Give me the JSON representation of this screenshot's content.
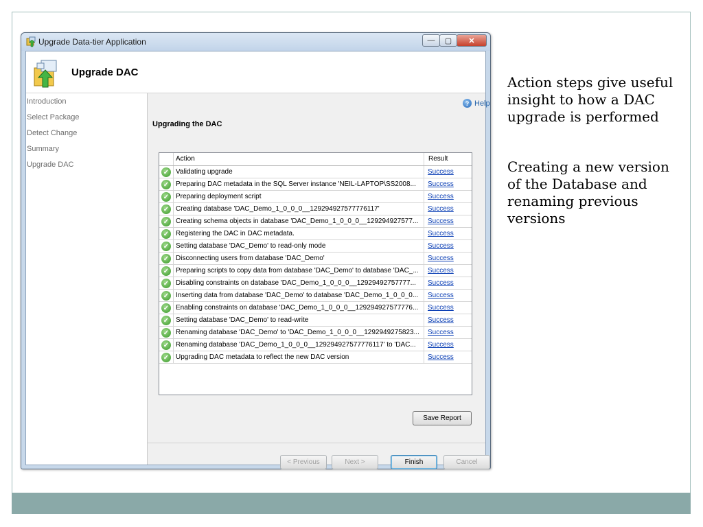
{
  "window": {
    "title": "Upgrade Data-tier Application",
    "header_title": "Upgrade DAC",
    "controls": {
      "minimize": "—",
      "maximize": "▢",
      "close": "✕"
    }
  },
  "nav": {
    "items": [
      {
        "label": "Introduction"
      },
      {
        "label": "Select Package"
      },
      {
        "label": "Detect Change"
      },
      {
        "label": "Summary"
      },
      {
        "label": "Upgrade DAC"
      }
    ]
  },
  "main": {
    "help_label": "Help",
    "section_title": "Upgrading the DAC",
    "columns": {
      "action": "Action",
      "result": "Result"
    },
    "rows": [
      {
        "action": "Validating upgrade",
        "result": "Success"
      },
      {
        "action": "Preparing DAC metadata in the SQL Server instance 'NEIL-LAPTOP\\SS2008...",
        "result": "Success"
      },
      {
        "action": "Preparing deployment script",
        "result": "Success"
      },
      {
        "action": "Creating database 'DAC_Demo_1_0_0_0__129294927577776117'",
        "result": "Success"
      },
      {
        "action": "Creating schema objects in database 'DAC_Demo_1_0_0_0__129294927577...",
        "result": "Success"
      },
      {
        "action": "Registering the DAC in DAC metadata.",
        "result": "Success"
      },
      {
        "action": "Setting database 'DAC_Demo' to read-only mode",
        "result": "Success"
      },
      {
        "action": "Disconnecting users from database 'DAC_Demo'",
        "result": "Success"
      },
      {
        "action": "Preparing scripts to copy data from database 'DAC_Demo' to database 'DAC_...",
        "result": "Success"
      },
      {
        "action": "Disabling constraints on database 'DAC_Demo_1_0_0_0__12929492757777...",
        "result": "Success"
      },
      {
        "action": "Inserting data from database 'DAC_Demo' to database 'DAC_Demo_1_0_0_0...",
        "result": "Success"
      },
      {
        "action": "Enabling constraints on database 'DAC_Demo_1_0_0_0__129294927577776...",
        "result": "Success"
      },
      {
        "action": "Setting database 'DAC_Demo' to read-write",
        "result": "Success"
      },
      {
        "action": "Renaming database 'DAC_Demo' to 'DAC_Demo_1_0_0_0__1292949275823...",
        "result": "Success"
      },
      {
        "action": "Renaming database 'DAC_Demo_1_0_0_0__129294927577776117' to 'DAC...",
        "result": "Success"
      },
      {
        "action": "Upgrading DAC metadata to reflect the new DAC version",
        "result": "Success"
      }
    ],
    "buttons": {
      "save_report": "Save Report",
      "previous": "< Previous",
      "next": "Next >",
      "finish": "Finish",
      "cancel": "Cancel"
    }
  },
  "slide": {
    "note_1": "Action steps give useful insight to how a DAC upgrade is performed",
    "note_2": "Creating a new version of the Database and renaming previous versions"
  },
  "colors": {
    "footer_band": "#8aa9a8",
    "success_link": "#0b3fb5",
    "check_green": "#3a9a2a"
  }
}
